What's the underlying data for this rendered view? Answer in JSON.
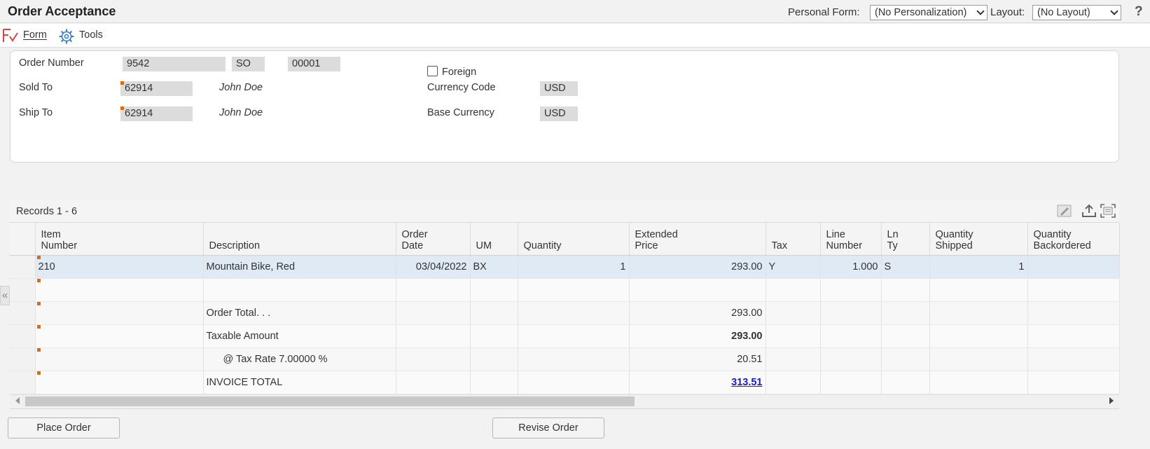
{
  "header": {
    "title": "Order Acceptance",
    "personal_form_label": "Personal Form:",
    "personal_form_value": "(No Personalization)",
    "layout_label": "Layout:",
    "layout_value": "(No Layout)",
    "help": "?"
  },
  "menu": {
    "form_label": "Form",
    "tools_label": "Tools"
  },
  "order": {
    "order_number_label": "Order Number",
    "order_number": "9542",
    "order_type": "SO",
    "company": "00001",
    "sold_to_label": "Sold To",
    "sold_to": "62914",
    "sold_to_name": "John Doe",
    "ship_to_label": "Ship To",
    "ship_to": "62914",
    "ship_to_name": "John Doe",
    "foreign_label": "Foreign",
    "foreign_checked": false,
    "currency_code_label": "Currency Code",
    "currency_code": "USD",
    "base_currency_label": "Base Currency",
    "base_currency": "USD"
  },
  "grid": {
    "records_label": "Records 1 - 6",
    "columns": {
      "item_number_1": "Item",
      "item_number_2": "Number",
      "description": "Description",
      "order_date_1": "Order",
      "order_date_2": "Date",
      "um": "UM",
      "quantity": "Quantity",
      "extended_price_1": "Extended",
      "extended_price_2": "Price",
      "tax": "Tax",
      "line_number_1": "Line",
      "line_number_2": "Number",
      "ln_ty_1": "Ln",
      "ln_ty_2": "Ty",
      "qty_shipped_1": "Quantity",
      "qty_shipped_2": "Shipped",
      "qty_backordered_1": "Quantity",
      "qty_backordered_2": "Backordered"
    },
    "rows": [
      {
        "item": "210",
        "description": "Mountain Bike, Red",
        "order_date": "03/04/2022",
        "um": "BX",
        "quantity": "1",
        "extended_price": "293.00",
        "tax": "Y",
        "line_number": "1.000",
        "ln_ty": "S",
        "qty_shipped": "1",
        "qty_backordered": ""
      },
      {
        "item": "",
        "description": "",
        "order_date": "",
        "um": "",
        "quantity": "",
        "extended_price": "",
        "tax": "",
        "line_number": "",
        "ln_ty": "",
        "qty_shipped": "",
        "qty_backordered": ""
      },
      {
        "item": "",
        "description": "Order Total. . .",
        "order_date": "",
        "um": "",
        "quantity": "",
        "extended_price": "293.00",
        "tax": "",
        "line_number": "",
        "ln_ty": "",
        "qty_shipped": "",
        "qty_backordered": ""
      },
      {
        "item": "",
        "description": "Taxable Amount",
        "order_date": "",
        "um": "",
        "quantity": "",
        "extended_price": "293.00",
        "tax": "",
        "line_number": "",
        "ln_ty": "",
        "qty_shipped": "",
        "qty_backordered": ""
      },
      {
        "item": "",
        "description": "@ Tax Rate 7.00000 %",
        "order_date": "",
        "um": "",
        "quantity": "",
        "extended_price": "20.51",
        "tax": "",
        "line_number": "",
        "ln_ty": "",
        "qty_shipped": "",
        "qty_backordered": ""
      },
      {
        "item": "",
        "description": "INVOICE TOTAL",
        "order_date": "",
        "um": "",
        "quantity": "",
        "extended_price": "313.51",
        "tax": "",
        "line_number": "",
        "ln_ty": "",
        "qty_shipped": "",
        "qty_backordered": ""
      }
    ]
  },
  "buttons": {
    "place_order": "Place Order",
    "revise_order": "Revise Order"
  },
  "colors": {
    "required_marker": "#e36a0a",
    "negative_red": "#e00000",
    "link_blue": "#1a1acc",
    "selected_row": "#dfeaf5"
  },
  "icons": [
    "form-icon",
    "tools-gear-icon",
    "help-icon",
    "chevron-down-icon",
    "edit-grid-icon",
    "export-icon",
    "fullscreen-icon",
    "collapse-left-icon"
  ]
}
